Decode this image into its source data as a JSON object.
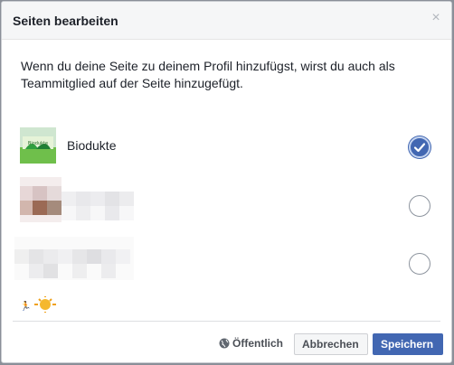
{
  "dialog": {
    "title": "Seiten bearbeiten",
    "close_icon": "close-icon",
    "intro": "Wenn du deine Seite zu deinem Profil hinzufügst, wirst du auch als Teammitglied auf der Seite hinzugefügt."
  },
  "pages": [
    {
      "name": "Biodukte",
      "checked": true
    },
    {
      "name": "",
      "checked": false
    },
    {
      "name": "",
      "checked": false
    }
  ],
  "footer": {
    "privacy_label": "Öffentlich",
    "cancel_label": "Abbrechen",
    "save_label": "Speichern"
  },
  "colors": {
    "accent": "#4267b2",
    "header_bg": "#f5f6f7"
  }
}
